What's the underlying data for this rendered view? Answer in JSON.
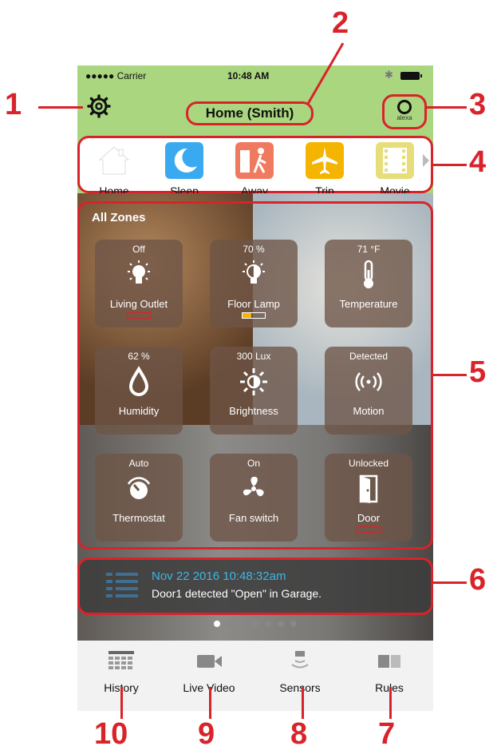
{
  "status_bar": {
    "carrier": "●●●●● Carrier",
    "time": "10:48 AM"
  },
  "header": {
    "title": "Home (Smith)",
    "alexa_label": "alexa"
  },
  "modes": [
    {
      "label": "Home",
      "icon": "house-icon",
      "color": "#ffffff"
    },
    {
      "label": "Sleep",
      "icon": "moon-icon",
      "color": "#3aaaf0"
    },
    {
      "label": "Away",
      "icon": "walking-person-icon",
      "color": "#f07a5f"
    },
    {
      "label": "Trip",
      "icon": "airplane-icon",
      "color": "#f5b400"
    },
    {
      "label": "Movie",
      "icon": "film-icon",
      "color": "#e6de7a"
    }
  ],
  "zones": {
    "title": "All Zones",
    "tiles": [
      {
        "value": "Off",
        "name": "Living Outlet",
        "icon": "bulb-icon",
        "battery": "low"
      },
      {
        "value": "70 %",
        "name": "Floor Lamp",
        "icon": "dimmer-bulb-icon",
        "battery": "medium"
      },
      {
        "value": "71 °F",
        "name": "Temperature",
        "icon": "thermometer-icon",
        "battery": ""
      },
      {
        "value": "62 %",
        "name": "Humidity",
        "icon": "droplet-icon",
        "battery": ""
      },
      {
        "value": "300 Lux",
        "name": "Brightness",
        "icon": "sun-icon",
        "battery": ""
      },
      {
        "value": "Detected",
        "name": "Motion",
        "icon": "motion-waves-icon",
        "battery": ""
      },
      {
        "value": "Auto",
        "name": "Thermostat",
        "icon": "dial-icon",
        "battery": ""
      },
      {
        "value": "On",
        "name": "Fan switch",
        "icon": "fan-icon",
        "battery": ""
      },
      {
        "value": "Unlocked",
        "name": "Door",
        "icon": "door-icon",
        "battery": "low"
      }
    ]
  },
  "notification": {
    "when": "Nov 22 2016  10:48:32am",
    "message": "Door1 detected \"Open\" in Garage."
  },
  "pager": {
    "count": 7,
    "active_index": 0
  },
  "tabs": [
    {
      "label": "History",
      "icon": "grid-calendar-icon"
    },
    {
      "label": "Live Video",
      "icon": "video-camera-icon"
    },
    {
      "label": "Sensors",
      "icon": "sensor-signal-icon"
    },
    {
      "label": "Rules",
      "icon": "rules-icon"
    }
  ],
  "callouts": [
    "1",
    "2",
    "3",
    "4",
    "5",
    "6",
    "7",
    "8",
    "9",
    "10"
  ],
  "colors": {
    "accent": "#d9232a",
    "header_bg": "#a9d67f",
    "notif_time": "#3db6e6"
  }
}
